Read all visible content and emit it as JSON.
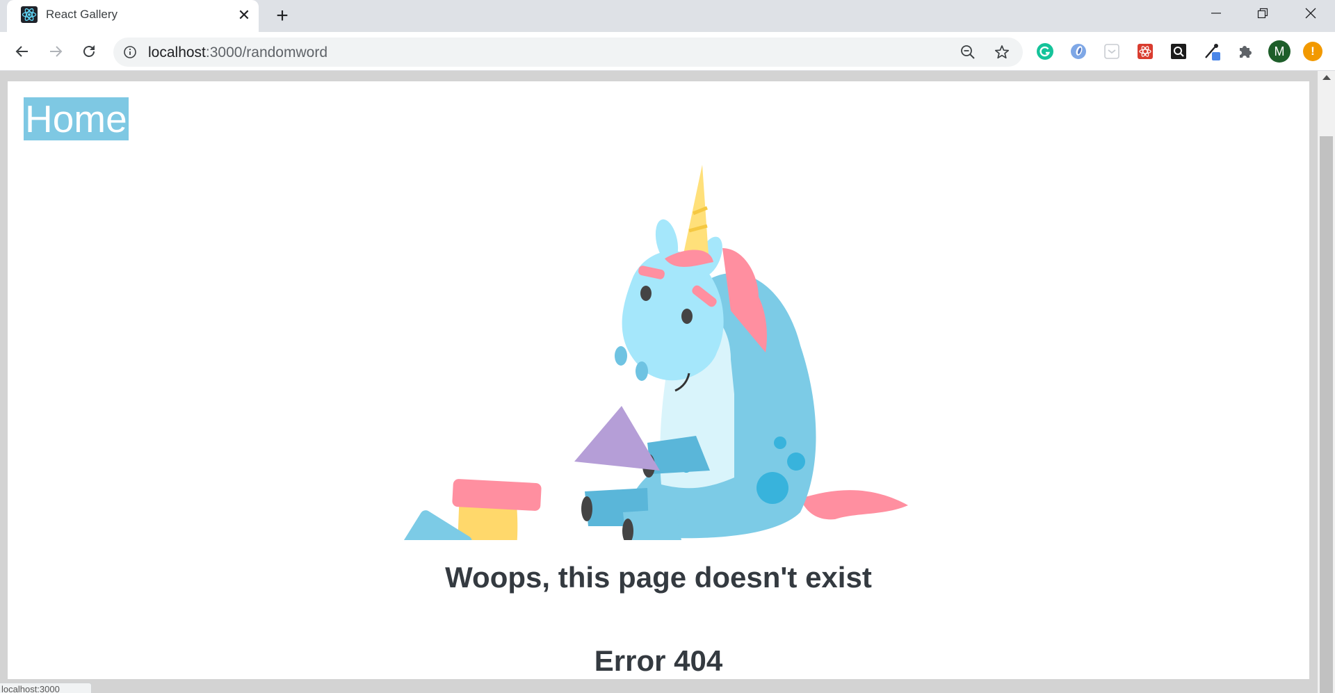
{
  "browser": {
    "tab": {
      "title": "React Gallery",
      "favicon": "react-atom-icon",
      "close_glyph": "✕"
    },
    "new_tab_glyph": "+",
    "url": {
      "host": "localhost",
      "path": ":3000/randomword"
    },
    "status_text": "localhost:3000"
  },
  "page": {
    "home_link": "Home",
    "heading": "Woops, this page doesn't exist",
    "error": "Error 404"
  },
  "extensions": {
    "profile_initial": "M",
    "update_glyph": "!"
  },
  "colors": {
    "home_bg": "#7ec8e3",
    "heading": "#343a40",
    "unicorn_body": "#7ccbe6",
    "unicorn_face": "#a5e7fb",
    "mane": "#ff8fa0",
    "horn": "#ffe07a"
  }
}
